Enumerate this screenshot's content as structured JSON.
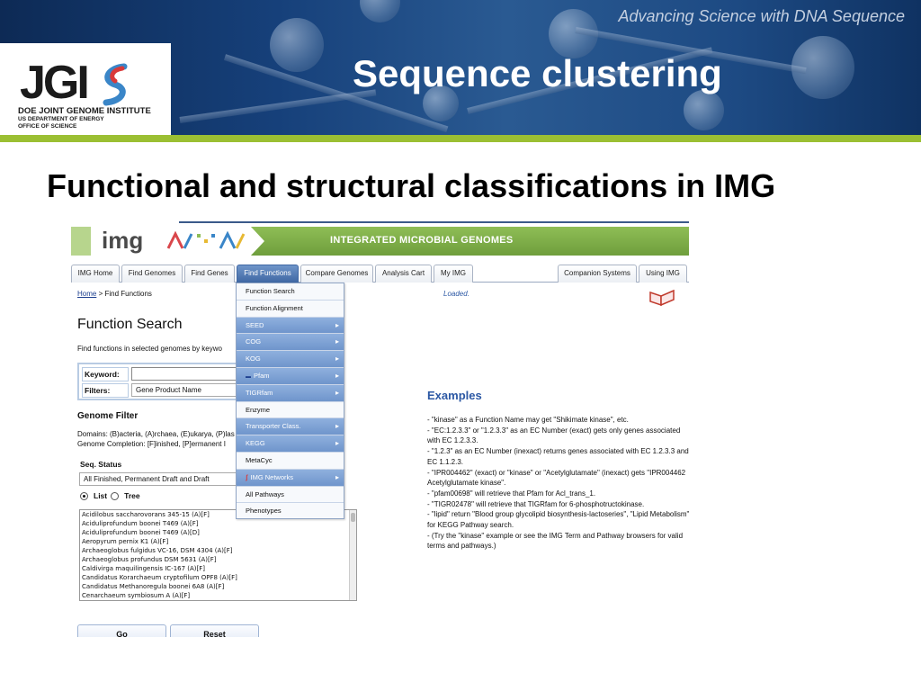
{
  "slide": {
    "tagline": "Advancing Science with DNA Sequence",
    "title": "Sequence clustering",
    "subtitle": "Functional and structural classifications in IMG",
    "logo": {
      "wordmark": "JGI",
      "line1": "DOE JOINT GENOME INSTITUTE",
      "line2": "US DEPARTMENT OF ENERGY",
      "line3": "OFFICE OF SCIENCE"
    },
    "colors": {
      "banner": "#16407a",
      "stripe": "#9bbf33",
      "img_green": "#7aab45",
      "menu_blue": "#6f95cc",
      "link_blue": "#2c58a4"
    }
  },
  "img": {
    "logo": "img",
    "banner_text": "INTEGRATED MICROBIAL GENOMES",
    "tabs": [
      "IMG Home",
      "Find Genomes",
      "Find Genes",
      "Find Functions",
      "Compare Genomes",
      "Analysis Cart",
      "My IMG",
      "Companion Systems",
      "Using IMG"
    ],
    "breadcrumb": {
      "home": "Home",
      "current": " > Find Functions"
    },
    "status": "Loaded.",
    "search": {
      "title": "Function Search",
      "description": "Find functions in selected genomes by keywo",
      "keyword_label": "Keyword:",
      "keyword_value": "",
      "filters_label": "Filters:",
      "filters_value": "Gene Product Name"
    },
    "genome_filter": {
      "title": "Genome Filter",
      "domains": "Domains: (B)acteria, (A)rchaea, (E)ukarya, (P)las",
      "completion": "Genome Completion: [F]inished, [P]ermanent I",
      "seq_status_label": "Seq. Status",
      "seq_status_value": "All Finished, Permanent Draft and Draft",
      "radio_list": "List",
      "radio_tree": "Tree",
      "genomes": [
        "Acidilobus saccharovorans 345-15 (A)[F]",
        "Aciduliprofundum boonei T469 (A)[F]",
        "Aciduliprofundum boonei T469 (A)[D]",
        "Aeropyrum pernix K1 (A)[F]",
        "Archaeoglobus fulgidus VC-16, DSM 4304 (A)[F]",
        "Archaeoglobus profundus DSM 5631 (A)[F]",
        "Caldivirga maquilingensis IC-167 (A)[F]",
        "Candidatus Korarchaeum cryptofilum OPF8 (A)[F]",
        "Candidatus Methanoregula boonei 6A8 (A)[F]",
        "Cenarchaeum symbiosum A (A)[F]"
      ]
    },
    "buttons": {
      "go": "Go",
      "reset": "Reset"
    },
    "menu": [
      {
        "label": "Function Search",
        "submenu": false
      },
      {
        "label": "Function Alignment",
        "submenu": false
      },
      {
        "label": "SEED",
        "submenu": true
      },
      {
        "label": "COG",
        "submenu": true
      },
      {
        "label": "KOG",
        "submenu": true
      },
      {
        "label": "Pfam",
        "submenu": true,
        "icon": "pfam-icon"
      },
      {
        "label": "TIGRfam",
        "submenu": true
      },
      {
        "label": "Enzyme",
        "submenu": false
      },
      {
        "label": "Transporter Class.",
        "submenu": true
      },
      {
        "label": "KEGG",
        "submenu": true
      },
      {
        "label": "MetaCyc",
        "submenu": false
      },
      {
        "label": "IMG Networks",
        "submenu": true,
        "icon": "img-networks-icon"
      },
      {
        "label": "All Pathways",
        "submenu": false
      },
      {
        "label": "Phenotypes",
        "submenu": false
      }
    ],
    "examples": {
      "title": "Examples",
      "items": [
        "- \"kinase\" as a Function Name may get \"Shikimate kinase\", etc.",
        "- \"EC:1.2.3.3\" or \"1.2.3.3\" as an EC Number (exact) gets only genes associated with EC 1.2.3.3.",
        "- \"1.2.3\" as an EC Number (inexact) returns genes associated with EC 1.2.3.3 and EC 1.1.2.3.",
        "- \"IPR004462\" (exact) or \"kinase\" or \"Acetylglutamate\" (inexact) gets \"IPR004462 Acetylglutamate kinase\".",
        "- \"pfam00698\" will retrieve that Pfam for Acl_trans_1.",
        "- \"TIGR02478\" will retrieve that TIGRfam for 6-phosphotructokinase.",
        "- \"lipid\" return \"Blood group glycolipid biosynthesis-lactoseries\", \"Lipid Metabolism\" for KEGG Pathway search.",
        "- (Try the \"kinase\" example or see the IMG Term and Pathway browsers for valid terms and pathways.)"
      ]
    }
  }
}
